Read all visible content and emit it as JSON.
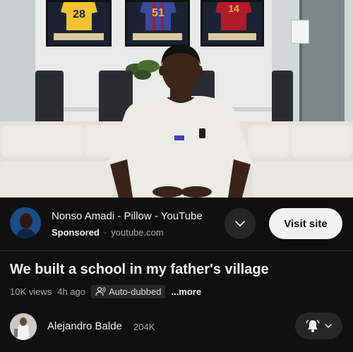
{
  "video": {
    "jerseys": [
      {
        "number": "28",
        "color": "#f1c232"
      },
      {
        "number": "51",
        "color": "#3b4a9a"
      },
      {
        "number": "14",
        "color": "#b11c2a"
      }
    ]
  },
  "sponsor": {
    "ad_title": "Nonso Amadi - Pillow - YouTube",
    "label": "Sponsored",
    "separator": "·",
    "domain": "youtube.com",
    "expand_icon": "chevron-down-icon",
    "visit_label": "Visit site"
  },
  "video_info": {
    "title": "We built a school in my father's village",
    "views": "10K views",
    "age": "4h ago",
    "auto_dubbed": "Auto-dubbed",
    "more": "...more"
  },
  "channel": {
    "name": "Alejandro Balde",
    "subscribers": "204K",
    "bell_icon": "bell-icon"
  },
  "colors": {
    "background": "#0f0f0f",
    "button_dark": "#272727",
    "button_light": "#f1f1f1",
    "text_secondary": "#aaaaaa"
  }
}
